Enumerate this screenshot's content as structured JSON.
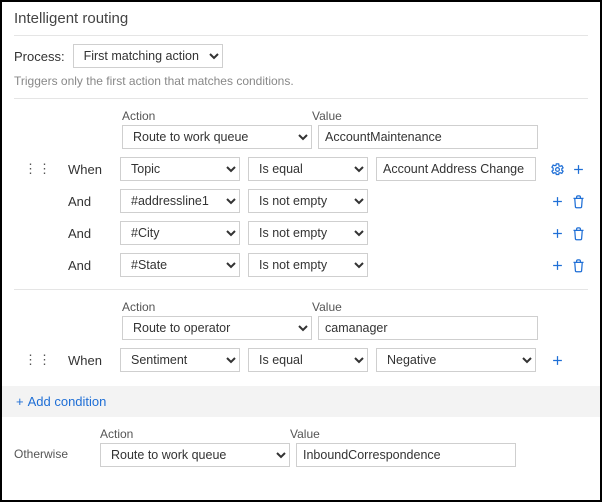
{
  "title": "Intelligent routing",
  "process": {
    "label": "Process:",
    "value": "First matching action",
    "hint": "Triggers only the first action that matches conditions."
  },
  "labels": {
    "action": "Action",
    "value": "Value",
    "when": "When",
    "and": "And",
    "otherwise": "Otherwise",
    "add_condition": "Add condition"
  },
  "groups": [
    {
      "action": "Route to work queue",
      "value": "AccountMaintenance",
      "conditions": [
        {
          "kw": "When",
          "field": "Topic",
          "op": "Is equal",
          "val": "Account Address Change",
          "gear": true
        },
        {
          "kw": "And",
          "field": "#addressline1",
          "op": "Is not empty",
          "val": "",
          "trash": true
        },
        {
          "kw": "And",
          "field": "#City",
          "op": "Is not empty",
          "val": "",
          "trash": true
        },
        {
          "kw": "And",
          "field": "#State",
          "op": "Is not empty",
          "val": "",
          "trash": true
        }
      ]
    },
    {
      "action": "Route to operator",
      "value": "camanager",
      "conditions": [
        {
          "kw": "When",
          "field": "Sentiment",
          "op": "Is equal",
          "val": "Negative"
        }
      ]
    }
  ],
  "otherwise": {
    "action": "Route to work queue",
    "value": "InboundCorrespondence"
  }
}
